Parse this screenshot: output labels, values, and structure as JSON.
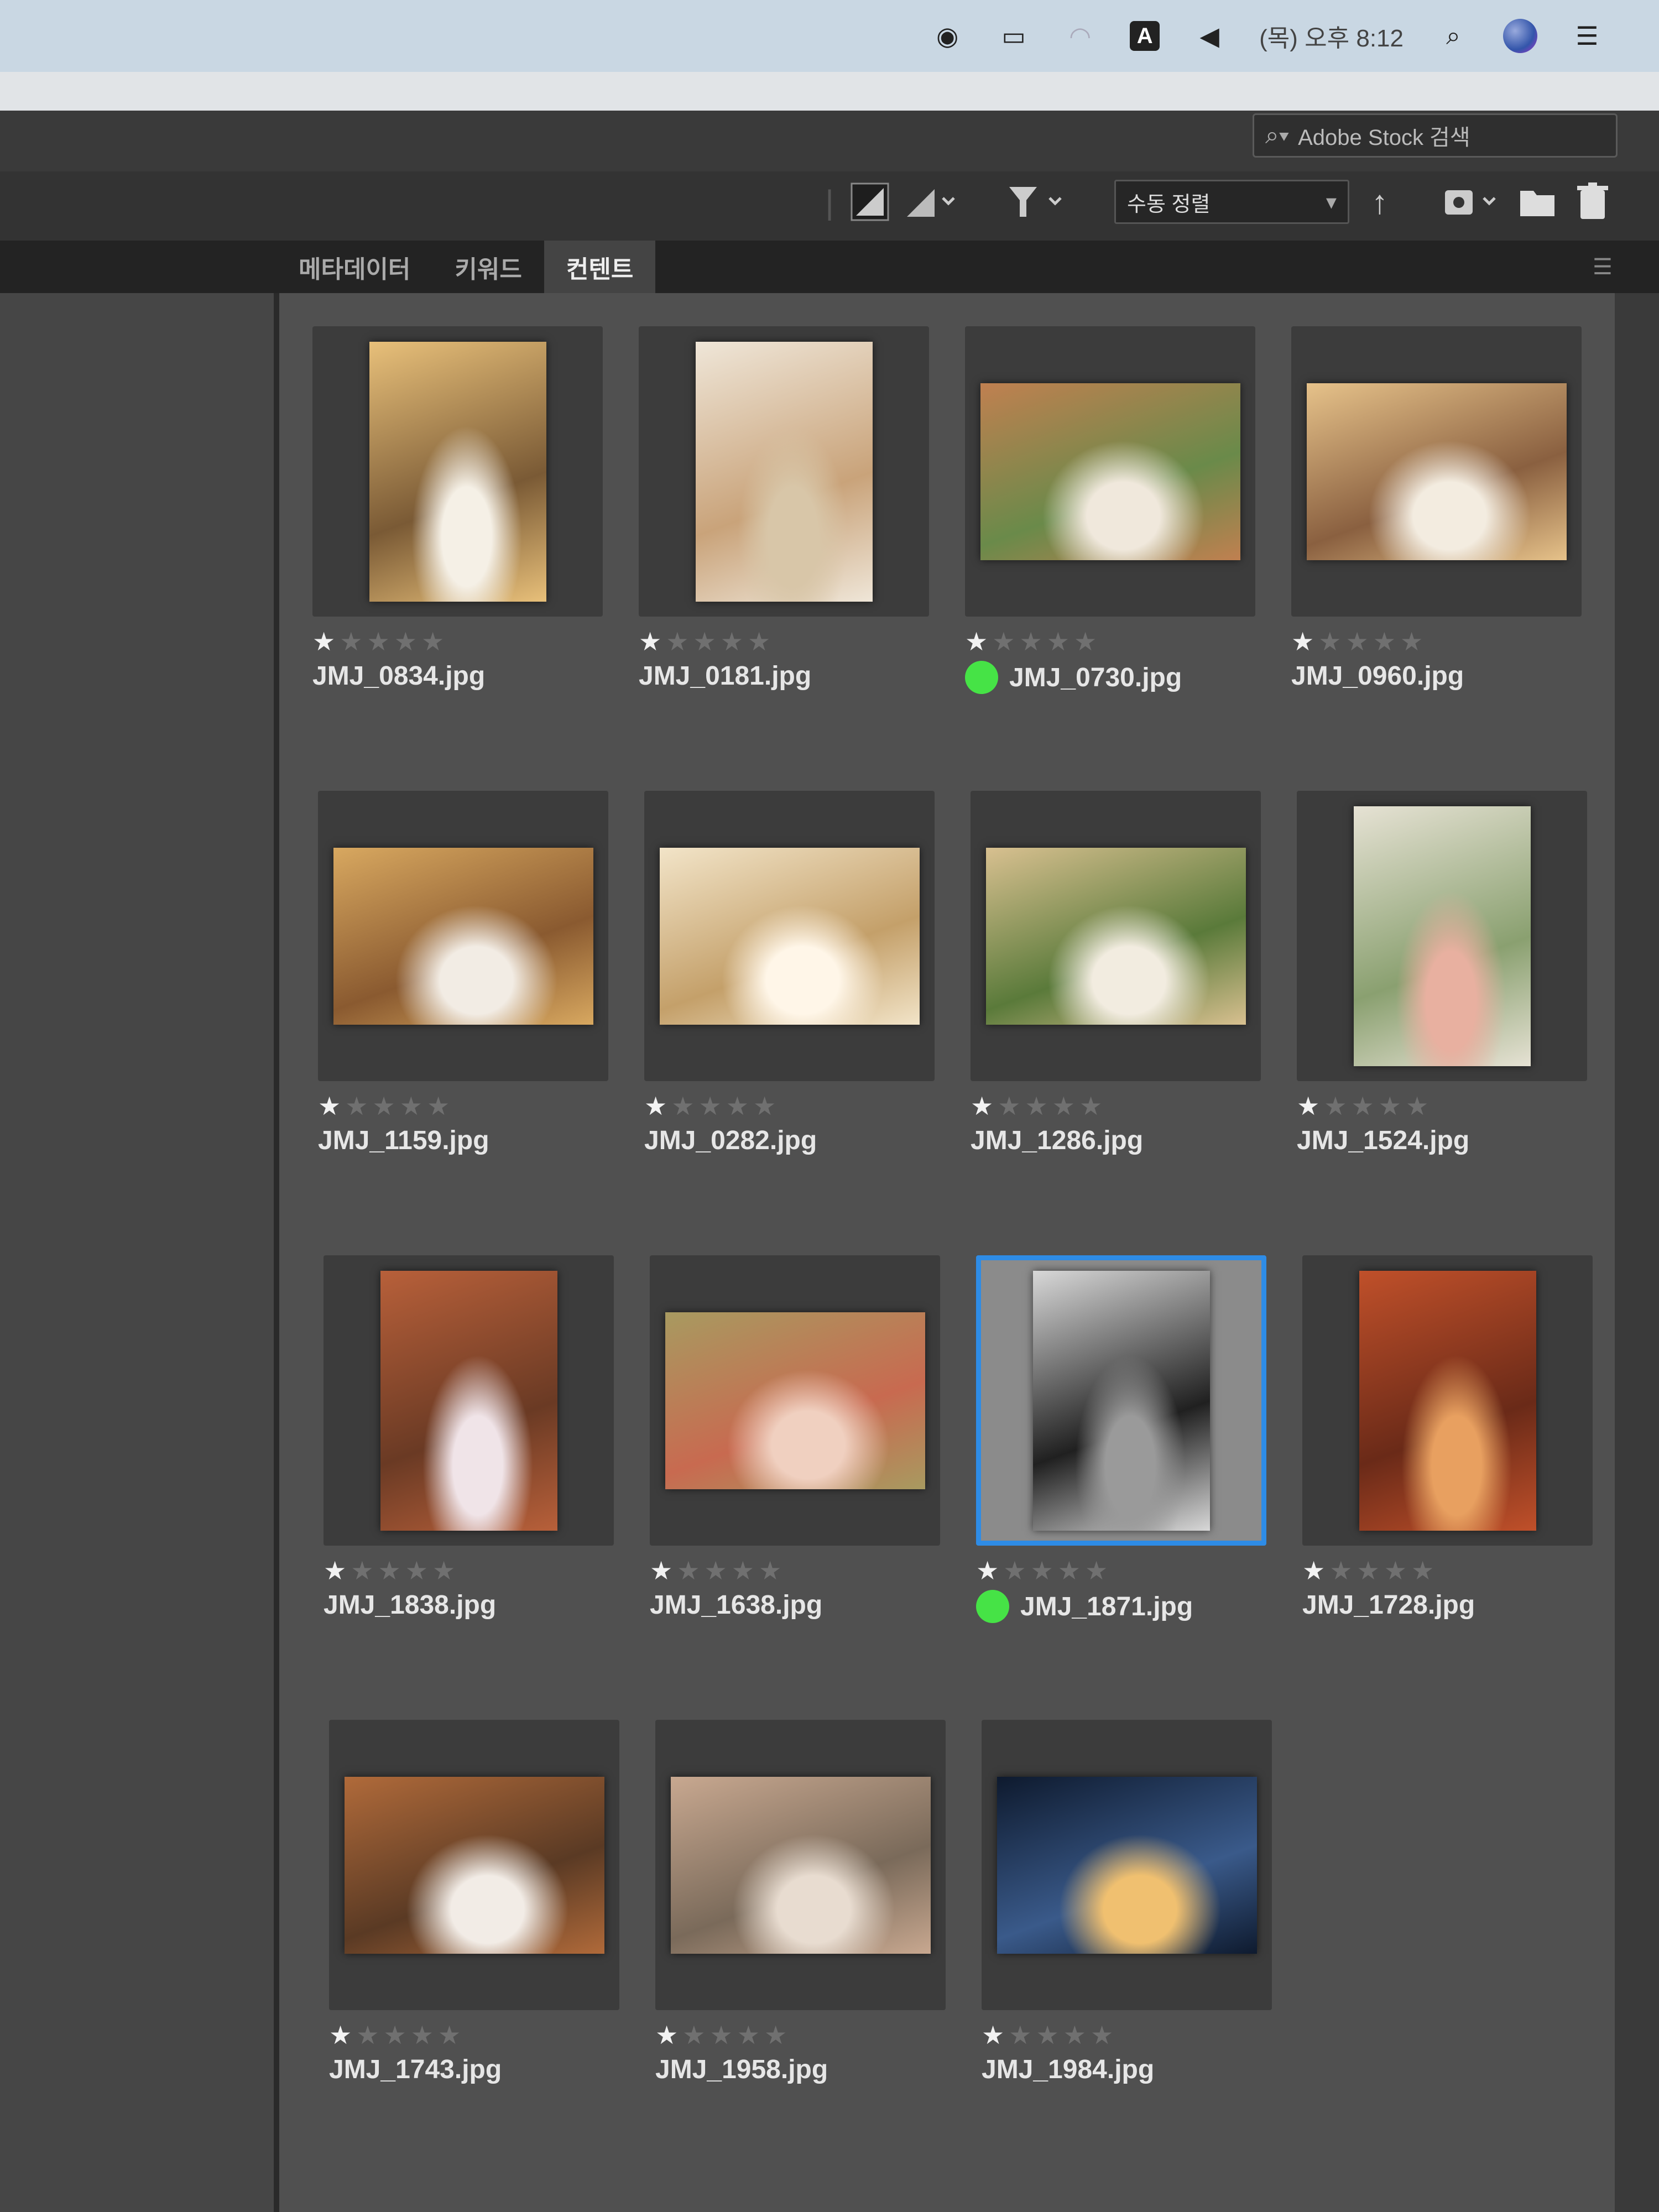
{
  "menubar": {
    "time": "(목) 오후 8:12",
    "input_source": "A"
  },
  "toolbar": {
    "stock_search_placeholder": "Adobe Stock 검색",
    "sort_label": "수동 정렬"
  },
  "tabs": [
    {
      "label": "메타데이터",
      "active": false
    },
    {
      "label": "키워드",
      "active": false
    },
    {
      "label": "컨텐트",
      "active": true
    }
  ],
  "grid": {
    "items": [
      {
        "filename": "JMJ_0834.jpg",
        "rating": 1,
        "orientation": "portrait",
        "label": null,
        "selected": false,
        "palette": [
          "#e8c07a",
          "#7a5a35",
          "#f5f0e6"
        ]
      },
      {
        "filename": "JMJ_0181.jpg",
        "rating": 1,
        "orientation": "portrait",
        "label": null,
        "selected": false,
        "palette": [
          "#efe6d8",
          "#c9a37a",
          "#d8c6a8"
        ]
      },
      {
        "filename": "JMJ_0730.jpg",
        "rating": 1,
        "orientation": "landscape",
        "label": "green",
        "selected": false,
        "palette": [
          "#c08050",
          "#6a8a4a",
          "#f0e8dc"
        ]
      },
      {
        "filename": "JMJ_0960.jpg",
        "rating": 1,
        "orientation": "landscape",
        "label": null,
        "selected": false,
        "palette": [
          "#e6c28a",
          "#8a6040",
          "#f3ece0"
        ]
      },
      {
        "filename": "JMJ_1159.jpg",
        "rating": 1,
        "orientation": "landscape",
        "label": null,
        "selected": false,
        "palette": [
          "#d8a860",
          "#8a5a30",
          "#f2ece4"
        ]
      },
      {
        "filename": "JMJ_0282.jpg",
        "rating": 1,
        "orientation": "landscape",
        "label": null,
        "selected": false,
        "palette": [
          "#f2e4c8",
          "#c4a06a",
          "#fff6e8"
        ]
      },
      {
        "filename": "JMJ_1286.jpg",
        "rating": 1,
        "orientation": "landscape",
        "label": null,
        "selected": false,
        "palette": [
          "#d8c090",
          "#5a7a3a",
          "#f2ece0"
        ]
      },
      {
        "filename": "JMJ_1524.jpg",
        "rating": 1,
        "orientation": "portrait",
        "label": null,
        "selected": false,
        "palette": [
          "#e6e2d4",
          "#8aa070",
          "#e8b0a0"
        ]
      },
      {
        "filename": "JMJ_1838.jpg",
        "rating": 1,
        "orientation": "portrait",
        "label": null,
        "selected": false,
        "palette": [
          "#b8603a",
          "#6a3a24",
          "#f0e4e8"
        ]
      },
      {
        "filename": "JMJ_1638.jpg",
        "rating": 1,
        "orientation": "landscape",
        "label": null,
        "selected": false,
        "palette": [
          "#a89a60",
          "#c86a50",
          "#f0d0c0"
        ]
      },
      {
        "filename": "JMJ_1871.jpg",
        "rating": 1,
        "orientation": "portrait",
        "label": "green",
        "selected": true,
        "palette": [
          "#d8d8d8",
          "#202020",
          "#9a9a9a"
        ]
      },
      {
        "filename": "JMJ_1728.jpg",
        "rating": 1,
        "orientation": "portrait",
        "label": null,
        "selected": false,
        "palette": [
          "#c0502a",
          "#6a2a18",
          "#e8a060"
        ]
      },
      {
        "filename": "JMJ_1743.jpg",
        "rating": 1,
        "orientation": "landscape",
        "label": null,
        "selected": false,
        "palette": [
          "#b06a3a",
          "#5a3a24",
          "#f2ece6"
        ]
      },
      {
        "filename": "JMJ_1958.jpg",
        "rating": 1,
        "orientation": "landscape",
        "label": null,
        "selected": false,
        "palette": [
          "#c8a890",
          "#7a6a5a",
          "#e8dcd0"
        ]
      },
      {
        "filename": "JMJ_1984.jpg",
        "rating": 1,
        "orientation": "landscape",
        "label": null,
        "selected": false,
        "palette": [
          "#0e1a2e",
          "#3a5a8a",
          "#f0c070"
        ]
      }
    ]
  },
  "colors": {
    "selection": "#2e8ce6",
    "label_green": "#46e346"
  }
}
